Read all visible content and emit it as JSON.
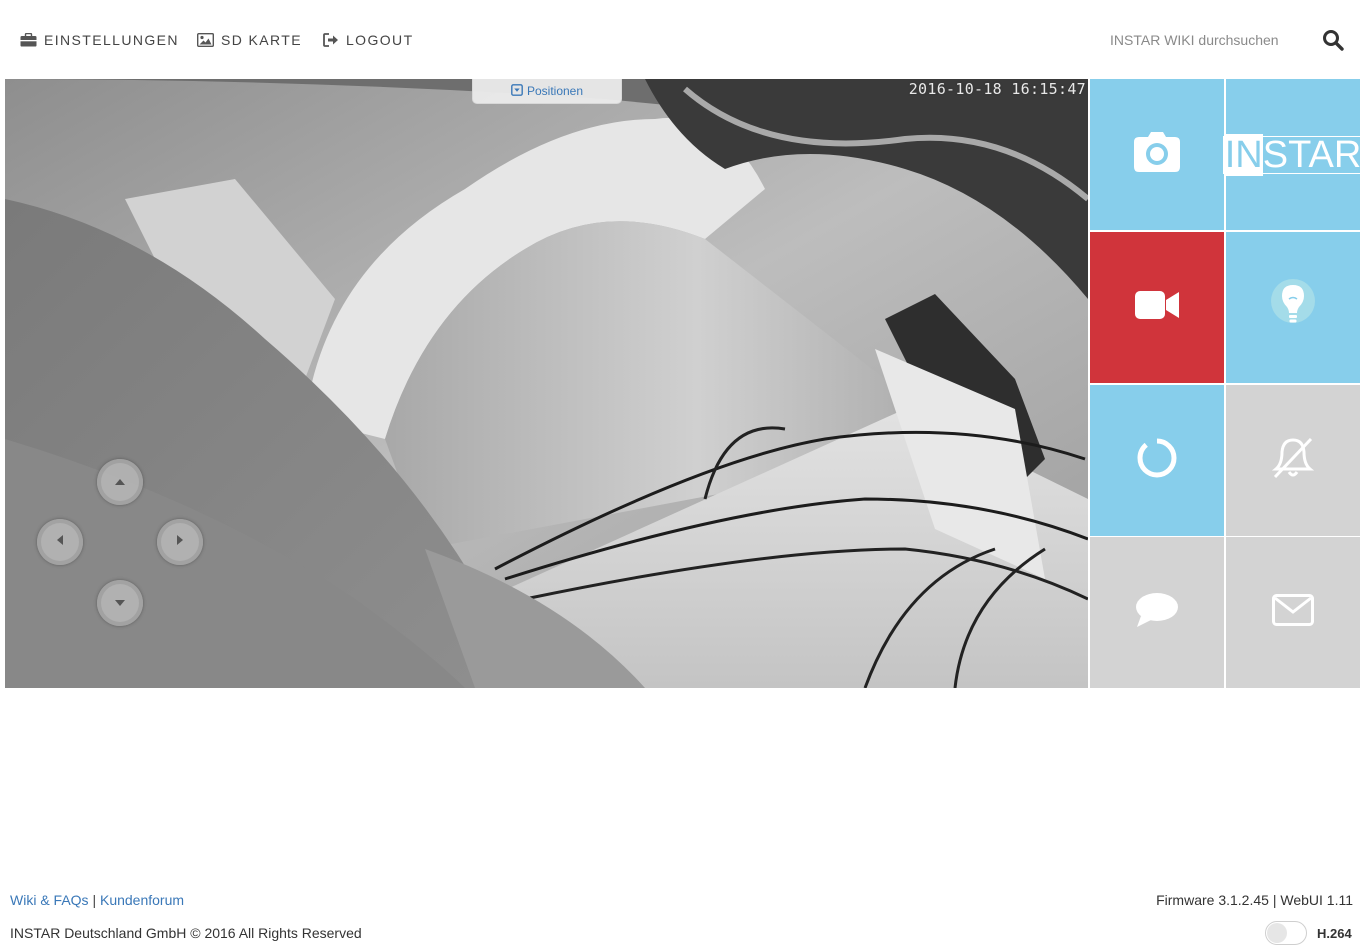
{
  "nav": {
    "settings_label": "EINSTELLUNGEN",
    "sdcard_label": "SD KARTE",
    "logout_label": "LOGOUT",
    "search_placeholder": "INSTAR WIKI durchsuchen",
    "icons": [
      "briefcase-icon",
      "image-icon",
      "sign-out-icon",
      "search-icon"
    ]
  },
  "video": {
    "timestamp": "2016-10-18 16:15:47",
    "positions_label": "Positionen",
    "ptz_controls": [
      "pan-up",
      "pan-left",
      "pan-right",
      "pan-down"
    ]
  },
  "tiles": {
    "logo": {
      "highlighted": "IN",
      "rest": "STAR"
    },
    "items": [
      {
        "name": "snapshot",
        "icon": "camera-icon",
        "color": "#87ceeb"
      },
      {
        "name": "brand",
        "icon": "instar-logo",
        "color": "#87ceeb"
      },
      {
        "name": "record",
        "icon": "video-camera-icon",
        "color": "#d0343b"
      },
      {
        "name": "ir-light",
        "icon": "lightbulb-icon",
        "color": "#87ceeb"
      },
      {
        "name": "loading",
        "icon": "spinner-icon",
        "color": "#87ceeb"
      },
      {
        "name": "alarm",
        "icon": "bell-slash-icon",
        "color": "#d3d3d3"
      },
      {
        "name": "audio",
        "icon": "speech-bubble-icon",
        "color": "#d3d3d3"
      },
      {
        "name": "email",
        "icon": "envelope-icon",
        "color": "#d3d3d3"
      }
    ]
  },
  "footer": {
    "wiki_link": "Wiki & FAQs",
    "separator": "|",
    "forum_link": "Kundenforum",
    "firmware": "Firmware 3.1.2.45",
    "webui": "WebUI 1.11",
    "copyright": "INSTAR Deutschland GmbH © 2016 All Rights Reserved",
    "codec": "H.264"
  }
}
